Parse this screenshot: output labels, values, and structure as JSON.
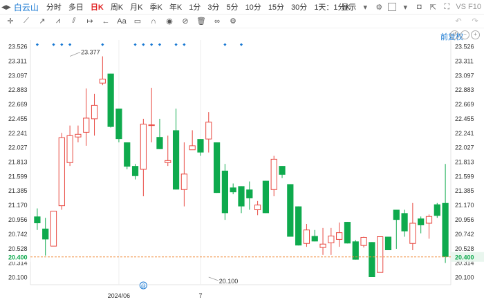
{
  "toolbar": {
    "stock_name": "白云山",
    "timeframes": [
      "分时",
      "多日",
      "日K",
      "周K",
      "月K",
      "季K",
      "年K",
      "1分",
      "3分",
      "5分",
      "10分",
      "15分",
      "30分",
      "1天：1分K"
    ],
    "active_timeframe": "日K",
    "display_label": "显示",
    "f10_label": "VS F10"
  },
  "rights_label": "前复权",
  "colors": {
    "up": "#e8473f",
    "down": "#0eaa4d",
    "current": "#f08c3c",
    "accent": "#1677d2"
  },
  "chart_data": {
    "type": "candlestick",
    "y_ticks": [
      "23.526",
      "23.311",
      "23.097",
      "22.883",
      "22.669",
      "22.455",
      "22.241",
      "22.027",
      "21.813",
      "21.599",
      "21.385",
      "21.170",
      "20.956",
      "20.742",
      "20.528",
      "20.314",
      "20.100"
    ],
    "ylim": [
      20.0,
      23.6
    ],
    "x_labels": [
      {
        "label": "2024/06",
        "index": 10
      },
      {
        "label": "7",
        "index": 20
      }
    ],
    "current_price": "20.400",
    "current_value": 20.4,
    "max_label": "23.377",
    "max_value": 23.377,
    "max_index": 4,
    "min_label": "20.100",
    "min_value": 20.1,
    "min_index": 21,
    "event_marker_indices": [
      0,
      2,
      3,
      4,
      8,
      12,
      13,
      14,
      15,
      17,
      18,
      23,
      25
    ],
    "candles": [
      {
        "o": 21.0,
        "h": 21.12,
        "l": 20.8,
        "c": 20.9
      },
      {
        "o": 20.82,
        "h": 20.98,
        "l": 20.42,
        "c": 20.66
      },
      {
        "o": 20.56,
        "h": 21.08,
        "l": 20.56,
        "c": 21.08
      },
      {
        "o": 21.16,
        "h": 22.24,
        "l": 21.1,
        "c": 22.17
      },
      {
        "o": 21.8,
        "h": 22.35,
        "l": 21.75,
        "c": 22.2
      },
      {
        "o": 22.18,
        "h": 22.35,
        "l": 22.1,
        "c": 22.22
      },
      {
        "o": 22.25,
        "h": 22.9,
        "l": 22.05,
        "c": 22.46
      },
      {
        "o": 22.45,
        "h": 22.82,
        "l": 22.2,
        "c": 22.65
      },
      {
        "o": 22.98,
        "h": 23.377,
        "l": 22.95,
        "c": 23.04
      },
      {
        "o": 23.12,
        "h": 23.12,
        "l": 22.32,
        "c": 22.33
      },
      {
        "o": 22.6,
        "h": 22.6,
        "l": 22.1,
        "c": 22.15
      },
      {
        "o": 22.1,
        "h": 22.1,
        "l": 21.7,
        "c": 21.74
      },
      {
        "o": 21.75,
        "h": 21.78,
        "l": 21.55,
        "c": 21.6
      },
      {
        "o": 21.7,
        "h": 22.45,
        "l": 21.3,
        "c": 22.37
      },
      {
        "o": 22.36,
        "h": 22.91,
        "l": 22.1,
        "c": 22.36
      },
      {
        "o": 22.18,
        "h": 22.45,
        "l": 22.0,
        "c": 22.0
      },
      {
        "o": 21.8,
        "h": 22.2,
        "l": 21.75,
        "c": 21.83
      },
      {
        "o": 22.28,
        "h": 22.6,
        "l": 21.4,
        "c": 21.4
      },
      {
        "o": 21.4,
        "h": 22.1,
        "l": 21.15,
        "c": 21.63
      },
      {
        "o": 21.99,
        "h": 22.28,
        "l": 22.05,
        "c": 22.05
      },
      {
        "o": 22.15,
        "h": 22.15,
        "l": 21.9,
        "c": 21.95
      },
      {
        "o": 22.15,
        "h": 22.55,
        "l": 21.95,
        "c": 22.4
      },
      {
        "o": 22.1,
        "h": 22.1,
        "l": 21.35,
        "c": 21.35
      },
      {
        "o": 21.68,
        "h": 21.78,
        "l": 20.95,
        "c": 21.05
      },
      {
        "o": 21.43,
        "h": 21.49,
        "l": 21.33,
        "c": 21.36
      },
      {
        "o": 21.45,
        "h": 21.45,
        "l": 21.05,
        "c": 21.15
      },
      {
        "o": 21.4,
        "h": 21.52,
        "l": 21.1,
        "c": 21.27
      },
      {
        "o": 21.1,
        "h": 21.23,
        "l": 21.02,
        "c": 21.17
      },
      {
        "o": 21.53,
        "h": 21.53,
        "l": 21.05,
        "c": 21.05
      },
      {
        "o": 21.4,
        "h": 21.9,
        "l": 21.3,
        "c": 21.85
      },
      {
        "o": 21.75,
        "h": 21.75,
        "l": 21.57,
        "c": 21.62
      },
      {
        "o": 21.48,
        "h": 21.48,
        "l": 20.7,
        "c": 20.7
      },
      {
        "o": 21.15,
        "h": 21.15,
        "l": 20.57,
        "c": 20.57
      },
      {
        "o": 20.6,
        "h": 20.89,
        "l": 20.55,
        "c": 20.8
      },
      {
        "o": 20.71,
        "h": 20.8,
        "l": 20.63,
        "c": 20.63
      },
      {
        "o": 20.54,
        "h": 20.83,
        "l": 20.43,
        "c": 20.59
      },
      {
        "o": 20.61,
        "h": 20.83,
        "l": 20.43,
        "c": 20.71
      },
      {
        "o": 20.66,
        "h": 20.91,
        "l": 20.55,
        "c": 20.76
      },
      {
        "o": 20.92,
        "h": 20.92,
        "l": 20.6,
        "c": 20.6
      },
      {
        "o": 20.63,
        "h": 20.65,
        "l": 20.36,
        "c": 20.36
      },
      {
        "o": 20.57,
        "h": 20.7,
        "l": 20.54,
        "c": 20.69
      },
      {
        "o": 20.62,
        "h": 20.62,
        "l": 20.1,
        "c": 20.1
      },
      {
        "o": 20.17,
        "h": 20.7,
        "l": 20.17,
        "c": 20.7
      },
      {
        "o": 20.7,
        "h": 20.7,
        "l": 20.5,
        "c": 20.5
      },
      {
        "o": 21.1,
        "h": 21.1,
        "l": 20.52,
        "c": 20.95
      },
      {
        "o": 21.05,
        "h": 21.1,
        "l": 20.7,
        "c": 20.78
      },
      {
        "o": 20.6,
        "h": 21.2,
        "l": 20.5,
        "c": 20.9
      },
      {
        "o": 20.97,
        "h": 21.0,
        "l": 20.75,
        "c": 20.87
      },
      {
        "o": 20.9,
        "h": 21.03,
        "l": 20.67,
        "c": 21.0
      },
      {
        "o": 21.18,
        "h": 21.2,
        "l": 20.98,
        "c": 21.01
      },
      {
        "o": 21.2,
        "h": 21.78,
        "l": 20.31,
        "c": 20.4
      }
    ]
  }
}
